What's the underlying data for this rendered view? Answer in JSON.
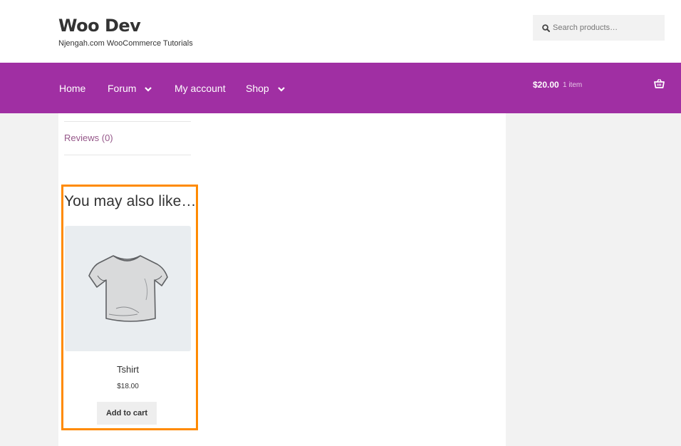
{
  "site": {
    "title": "Woo Dev",
    "tagline": "Njengah.com WooCommerce Tutorials"
  },
  "search": {
    "placeholder": "Search products…",
    "icon": "search-icon"
  },
  "nav": {
    "items": [
      {
        "label": "Home",
        "has_dropdown": false
      },
      {
        "label": "Forum",
        "has_dropdown": true
      },
      {
        "label": "My account",
        "has_dropdown": false
      },
      {
        "label": "Shop",
        "has_dropdown": true
      }
    ],
    "background_color": "#a02fa3"
  },
  "cart": {
    "total": "$20.00",
    "count": "1 item",
    "icon": "basket-icon"
  },
  "tabs": {
    "reviews_label": "Reviews (0)"
  },
  "related": {
    "heading": "You may also like…",
    "products": [
      {
        "name": "Tshirt",
        "price": "$18.00",
        "button_label": "Add to cart"
      }
    ]
  },
  "colors": {
    "link": "#96588a",
    "highlight_border": "#ff8a00"
  }
}
